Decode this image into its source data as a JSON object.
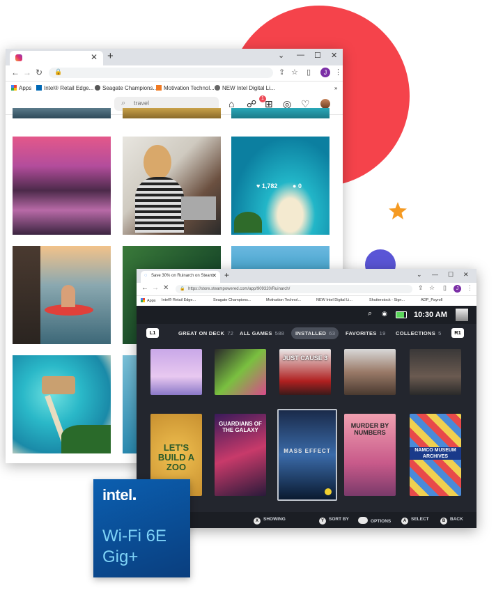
{
  "browser1": {
    "address_value": "",
    "bookmarks": [
      "Apps",
      "Intel® Retail Edge...",
      "Seagate Champions...",
      "Motivation Technol...",
      "NEW Intel Digital Li..."
    ],
    "profile_initial": "J",
    "instagram": {
      "search_placeholder": "travel",
      "notification_count": "1",
      "post_likes": "1,782",
      "post_comments": "0"
    }
  },
  "browser2": {
    "tab_title": "Save 30% on Ruinarch on Steam",
    "url": "https://store.steampowered.com/app/909320/Ruinarch/",
    "profile_initial": "J",
    "bookmarks": [
      "Apps",
      "Intel® Retail Edge...",
      "Seagate Champions...",
      "Motivation Technol...",
      "NEW Intel Digital Li...",
      "Shutterstock - Sign...",
      "ADP_Payroll"
    ],
    "steam_deck": {
      "time": "10:30 AM",
      "left_bumper": "L1",
      "right_bumper": "R1",
      "tabs": [
        {
          "label": "GREAT ON DECK",
          "count": "72"
        },
        {
          "label": "ALL GAMES",
          "count": "588"
        },
        {
          "label": "INSTALLED",
          "count": "63"
        },
        {
          "label": "FAVORITES",
          "count": "19"
        },
        {
          "label": "COLLECTIONS",
          "count": "5"
        }
      ],
      "games_row2": [
        "LET'S BUILD A ZOO",
        "GUARDIANS OF THE GALAXY",
        "MASS EFFECT",
        "MURDER BY NUMBERS",
        "NAMCO MUSEUM ARCHIVES"
      ],
      "games_row1": [
        "",
        "",
        "JUST CAUSE 3",
        "",
        ""
      ],
      "bottom": {
        "showing": "SHOWING",
        "sort": "SORT BY",
        "options": "OPTIONS",
        "select": "SELECT",
        "back": "BACK",
        "btn_x": "X",
        "btn_y": "Y",
        "btn_a": "A",
        "btn_b": "B"
      }
    }
  },
  "intel_badge": {
    "logo": "intel",
    "line1": "Wi-Fi 6E",
    "line2": "Gig+"
  },
  "colors": {
    "red_circle": "#f5434b",
    "blue_circle": "#5a55d6",
    "star": "#f59a22",
    "intel_blue": "#0b5fb0",
    "intel_text": "#7fd3f7"
  }
}
